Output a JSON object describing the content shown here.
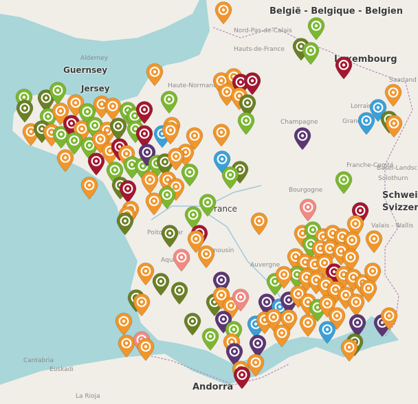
{
  "map": {
    "labels": {
      "belgium": "België - Belgique - Belgien",
      "luxembourg": "Luxembourg",
      "guernsey": "Guernsey",
      "jersey": "Jersey",
      "france": "France",
      "schweiz": "Schweiz",
      "svizzera": "Svizzera",
      "andorra": "Andorra",
      "euskadi": "Euskadi",
      "cantabria": "Cantabria",
      "rioja": "La Rioja",
      "alderney": "Alderney",
      "nord_pas_de_calais": "Nord-Pas-de-Calais",
      "hauts_de_france": "Hauts-de-France",
      "haute_normandie": "Haute-Normandie",
      "champagne": "Champagne",
      "lorraine": "Lorraine",
      "grand_est": "Grand Est",
      "franche_comte": "Franche-Comté",
      "bourgogne": "Bourgogne",
      "auvergne": "Auvergne",
      "limousin": "Limousin",
      "aquitaine": "Aquitaine",
      "poitou": "Poitou-Char",
      "valais": "Valais - Wallis",
      "basel": "Basel-Landschaft",
      "solothurn": "Solothurn",
      "saarland": "Saarland"
    },
    "colors": {
      "sea": "#a8d6d9",
      "land": "#f1eee8",
      "border": "#b08ab5",
      "marker_orange": "#f0962c",
      "marker_green": "#7cb731",
      "marker_olive": "#6b7f25",
      "marker_darkred": "#a3172f",
      "marker_purple": "#5c3673",
      "marker_blue": "#3ba0d8",
      "marker_pink": "#f08a82"
    },
    "marker_icon": "target-icon"
  }
}
